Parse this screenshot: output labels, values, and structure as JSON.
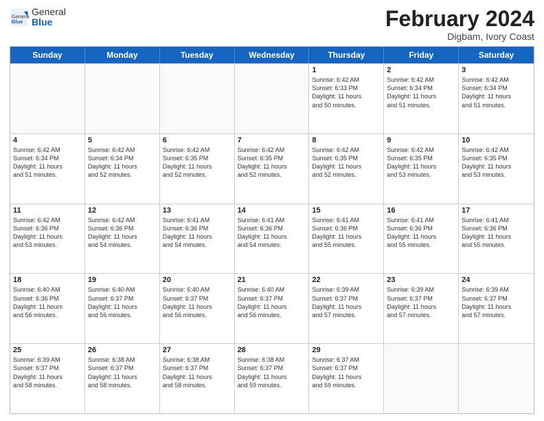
{
  "header": {
    "logo_general": "General",
    "logo_blue": "Blue",
    "month_year": "February 2024",
    "location": "Digbam, Ivory Coast"
  },
  "days_of_week": [
    "Sunday",
    "Monday",
    "Tuesday",
    "Wednesday",
    "Thursday",
    "Friday",
    "Saturday"
  ],
  "weeks": [
    [
      {
        "day": "",
        "info": ""
      },
      {
        "day": "",
        "info": ""
      },
      {
        "day": "",
        "info": ""
      },
      {
        "day": "",
        "info": ""
      },
      {
        "day": "1",
        "info": "Sunrise: 6:42 AM\nSunset: 6:33 PM\nDaylight: 11 hours\nand 50 minutes."
      },
      {
        "day": "2",
        "info": "Sunrise: 6:42 AM\nSunset: 6:34 PM\nDaylight: 11 hours\nand 51 minutes."
      },
      {
        "day": "3",
        "info": "Sunrise: 6:42 AM\nSunset: 6:34 PM\nDaylight: 11 hours\nand 51 minutes."
      }
    ],
    [
      {
        "day": "4",
        "info": "Sunrise: 6:42 AM\nSunset: 6:34 PM\nDaylight: 11 hours\nand 51 minutes."
      },
      {
        "day": "5",
        "info": "Sunrise: 6:42 AM\nSunset: 6:34 PM\nDaylight: 11 hours\nand 52 minutes."
      },
      {
        "day": "6",
        "info": "Sunrise: 6:42 AM\nSunset: 6:35 PM\nDaylight: 11 hours\nand 52 minutes."
      },
      {
        "day": "7",
        "info": "Sunrise: 6:42 AM\nSunset: 6:35 PM\nDaylight: 11 hours\nand 52 minutes."
      },
      {
        "day": "8",
        "info": "Sunrise: 6:42 AM\nSunset: 6:35 PM\nDaylight: 11 hours\nand 52 minutes."
      },
      {
        "day": "9",
        "info": "Sunrise: 6:42 AM\nSunset: 6:35 PM\nDaylight: 11 hours\nand 53 minutes."
      },
      {
        "day": "10",
        "info": "Sunrise: 6:42 AM\nSunset: 6:35 PM\nDaylight: 11 hours\nand 53 minutes."
      }
    ],
    [
      {
        "day": "11",
        "info": "Sunrise: 6:42 AM\nSunset: 6:36 PM\nDaylight: 11 hours\nand 53 minutes."
      },
      {
        "day": "12",
        "info": "Sunrise: 6:42 AM\nSunset: 6:36 PM\nDaylight: 11 hours\nand 54 minutes."
      },
      {
        "day": "13",
        "info": "Sunrise: 6:41 AM\nSunset: 6:36 PM\nDaylight: 11 hours\nand 54 minutes."
      },
      {
        "day": "14",
        "info": "Sunrise: 6:41 AM\nSunset: 6:36 PM\nDaylight: 11 hours\nand 54 minutes."
      },
      {
        "day": "15",
        "info": "Sunrise: 6:41 AM\nSunset: 6:36 PM\nDaylight: 11 hours\nand 55 minutes."
      },
      {
        "day": "16",
        "info": "Sunrise: 6:41 AM\nSunset: 6:36 PM\nDaylight: 11 hours\nand 55 minutes."
      },
      {
        "day": "17",
        "info": "Sunrise: 6:41 AM\nSunset: 6:36 PM\nDaylight: 11 hours\nand 55 minutes."
      }
    ],
    [
      {
        "day": "18",
        "info": "Sunrise: 6:40 AM\nSunset: 6:36 PM\nDaylight: 11 hours\nand 56 minutes."
      },
      {
        "day": "19",
        "info": "Sunrise: 6:40 AM\nSunset: 6:37 PM\nDaylight: 11 hours\nand 56 minutes."
      },
      {
        "day": "20",
        "info": "Sunrise: 6:40 AM\nSunset: 6:37 PM\nDaylight: 11 hours\nand 56 minutes."
      },
      {
        "day": "21",
        "info": "Sunrise: 6:40 AM\nSunset: 6:37 PM\nDaylight: 11 hours\nand 56 minutes."
      },
      {
        "day": "22",
        "info": "Sunrise: 6:39 AM\nSunset: 6:37 PM\nDaylight: 11 hours\nand 57 minutes."
      },
      {
        "day": "23",
        "info": "Sunrise: 6:39 AM\nSunset: 6:37 PM\nDaylight: 11 hours\nand 57 minutes."
      },
      {
        "day": "24",
        "info": "Sunrise: 6:39 AM\nSunset: 6:37 PM\nDaylight: 11 hours\nand 57 minutes."
      }
    ],
    [
      {
        "day": "25",
        "info": "Sunrise: 6:39 AM\nSunset: 6:37 PM\nDaylight: 11 hours\nand 58 minutes."
      },
      {
        "day": "26",
        "info": "Sunrise: 6:38 AM\nSunset: 6:37 PM\nDaylight: 11 hours\nand 58 minutes."
      },
      {
        "day": "27",
        "info": "Sunrise: 6:38 AM\nSunset: 6:37 PM\nDaylight: 11 hours\nand 58 minutes."
      },
      {
        "day": "28",
        "info": "Sunrise: 6:38 AM\nSunset: 6:37 PM\nDaylight: 11 hours\nand 59 minutes."
      },
      {
        "day": "29",
        "info": "Sunrise: 6:37 AM\nSunset: 6:37 PM\nDaylight: 11 hours\nand 59 minutes."
      },
      {
        "day": "",
        "info": ""
      },
      {
        "day": "",
        "info": ""
      }
    ]
  ]
}
